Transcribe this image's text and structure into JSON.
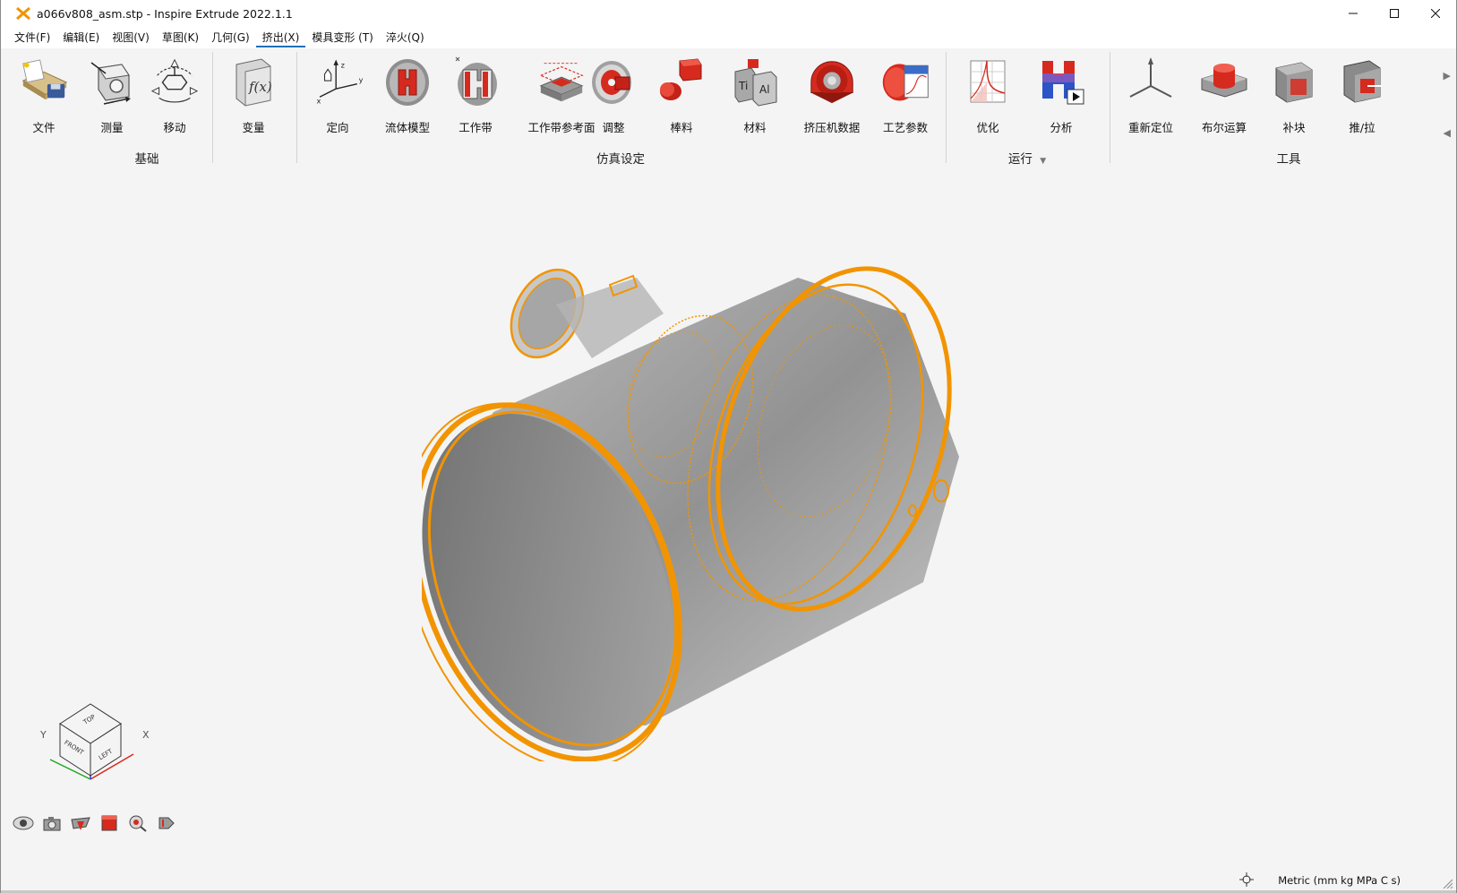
{
  "window": {
    "title": "a066v808_asm.stp - Inspire Extrude 2022.1.1",
    "controls": [
      "minimize",
      "maximize",
      "close"
    ]
  },
  "menu": {
    "items": [
      {
        "label": "文件(F)",
        "active": false
      },
      {
        "label": "编辑(E)",
        "active": false
      },
      {
        "label": "视图(V)",
        "active": false
      },
      {
        "label": "草图(K)",
        "active": false
      },
      {
        "label": "几何(G)",
        "active": false
      },
      {
        "label": "挤出(X)",
        "active": true
      },
      {
        "label": "模具变形 (T)",
        "active": false
      },
      {
        "label": "淬火(Q)",
        "active": false
      }
    ]
  },
  "ribbon": {
    "groups": {
      "basics": "基础",
      "simulation_setup": "仿真设定",
      "run": "运行",
      "tools": "工具"
    },
    "tools": {
      "file": "文件",
      "measure": "测量",
      "move": "移动",
      "variables": "变量",
      "orient": "定向",
      "flow_model": "流体模型",
      "bearing": "工作带",
      "bearing_ref_plane": "工作带参考面",
      "adjust": "调整",
      "billet": "棒料",
      "material": "材料",
      "press_data": "挤压机数据",
      "process_params": "工艺参数",
      "optimize": "优化",
      "analyze": "分析",
      "reposition": "重新定位",
      "boolean": "布尔运算",
      "patch": "补块",
      "push_pull": "推/拉"
    }
  },
  "viewcube": {
    "faces": {
      "top": "TOP",
      "front": "FRONT",
      "left": "LEFT"
    },
    "axes": {
      "x": "X",
      "y": "Y"
    }
  },
  "status": {
    "units": "Metric (mm kg MPa C s)"
  },
  "colors": {
    "accent_orange": "#f29400",
    "model_gray": "#8c8c8c",
    "menu_underline": "#1f6fb5"
  }
}
